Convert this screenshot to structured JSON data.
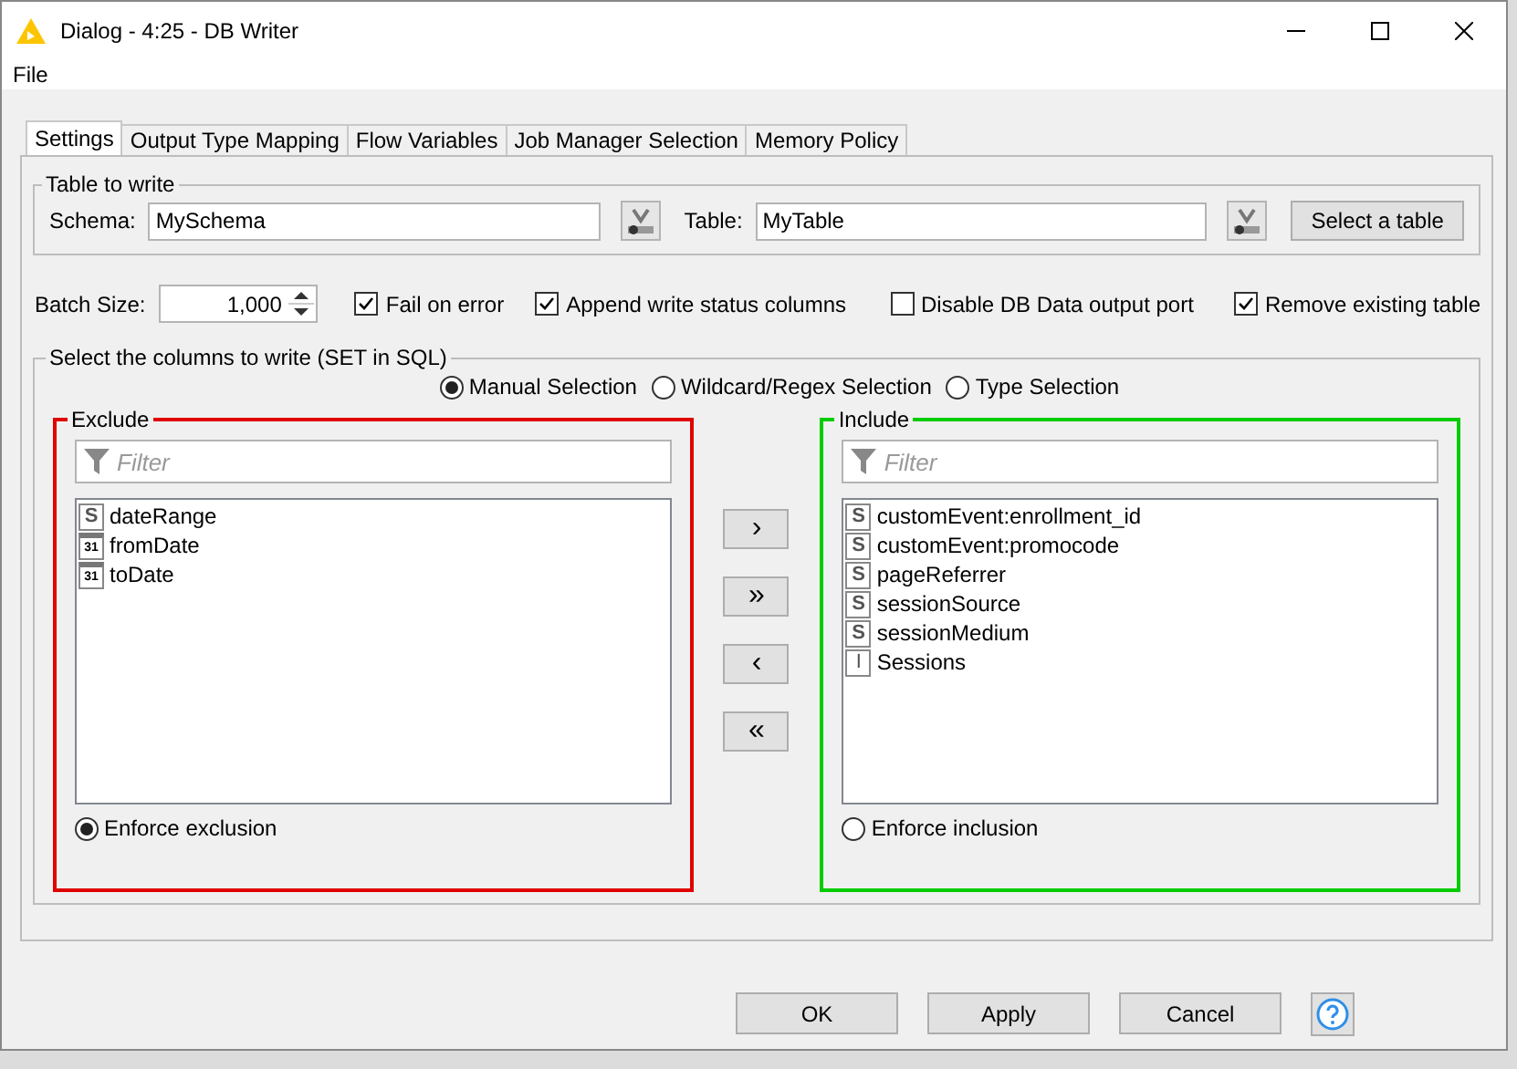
{
  "window": {
    "title": "Dialog - 4:25 - DB Writer"
  },
  "menu": [
    "File"
  ],
  "tabs": [
    {
      "label": "Settings",
      "selected": true
    },
    {
      "label": "Output Type Mapping",
      "selected": false
    },
    {
      "label": "Flow Variables",
      "selected": false
    },
    {
      "label": "Job Manager Selection",
      "selected": false
    },
    {
      "label": "Memory Policy",
      "selected": false
    }
  ],
  "table_to_write": {
    "title": "Table to write",
    "schema_label": "Schema:",
    "schema_value": "MySchema",
    "table_label": "Table:",
    "table_value": "MyTable",
    "select_button": "Select a table"
  },
  "batch": {
    "label": "Batch Size:",
    "value": "1,000"
  },
  "options": [
    {
      "label": "Fail on error",
      "checked": true
    },
    {
      "label": "Append write status columns",
      "checked": true
    },
    {
      "label": "Disable DB Data output port",
      "checked": false
    },
    {
      "label": "Remove existing table",
      "checked": true
    }
  ],
  "columns": {
    "title": "Select the columns to write (SET in SQL)",
    "modes": [
      {
        "label": "Manual Selection",
        "selected": true
      },
      {
        "label": "Wildcard/Regex Selection",
        "selected": false
      },
      {
        "label": "Type Selection",
        "selected": false
      }
    ],
    "exclude": {
      "title": "Exclude",
      "color": "#e00000",
      "filter_placeholder": "Filter",
      "enforce_label": "Enforce exclusion",
      "enforce_selected": true,
      "items": [
        {
          "kind": "string",
          "badge": "S",
          "name": "dateRange"
        },
        {
          "kind": "date",
          "badge": "31",
          "name": "fromDate"
        },
        {
          "kind": "date",
          "badge": "31",
          "name": "toDate"
        }
      ]
    },
    "include": {
      "title": "Include",
      "color": "#00cc00",
      "filter_placeholder": "Filter",
      "enforce_label": "Enforce inclusion",
      "enforce_selected": false,
      "items": [
        {
          "kind": "string",
          "badge": "S",
          "name": "customEvent:enrollment_id"
        },
        {
          "kind": "string",
          "badge": "S",
          "name": "customEvent:promocode"
        },
        {
          "kind": "string",
          "badge": "S",
          "name": "pageReferrer"
        },
        {
          "kind": "string",
          "badge": "S",
          "name": "sessionSource"
        },
        {
          "kind": "string",
          "badge": "S",
          "name": "sessionMedium"
        },
        {
          "kind": "integer",
          "badge": "I",
          "name": "Sessions"
        }
      ]
    },
    "move_buttons": [
      "›",
      "»",
      "‹",
      "«"
    ]
  },
  "buttons": [
    "OK",
    "Apply",
    "Cancel"
  ]
}
